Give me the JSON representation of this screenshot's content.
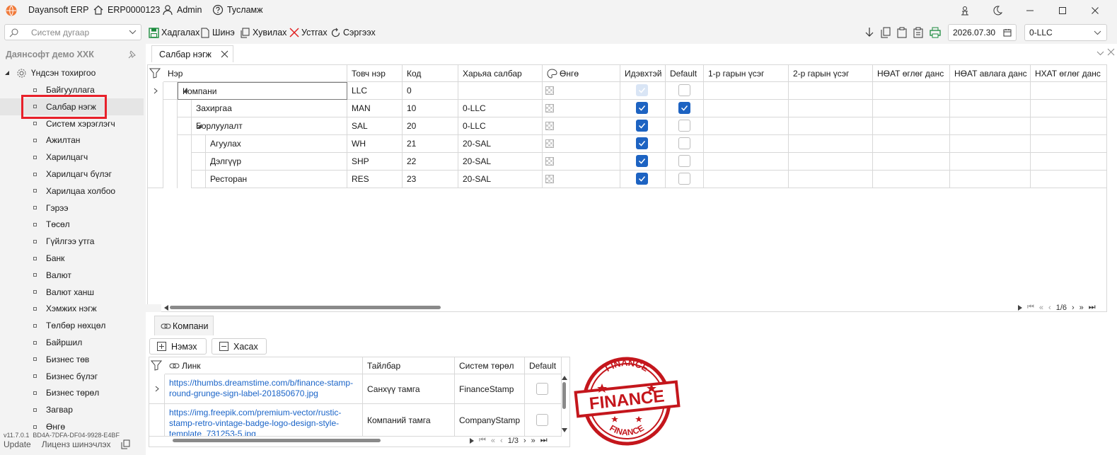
{
  "app": {
    "title": "Dayansoft ERP",
    "system_number": "ERP0000123",
    "user": "Admin",
    "help": "Тусламж"
  },
  "toolbar": {
    "search_placeholder": "Систем дугаар",
    "save": "Хадгалах",
    "new": "Шинэ",
    "copy": "Хувилах",
    "delete": "Устгах",
    "refresh": "Сэргээх",
    "date": "2026.07.30",
    "branch": "0-LLC"
  },
  "sidebar": {
    "title": "Даянсофт демо ХХК",
    "root": "Үндсэн тохиргоо",
    "items": [
      "Байгууллага",
      "Салбар нэгж",
      "Систем хэрэглэгч",
      "Ажилтан",
      "Харилцагч",
      "Харилцагч бүлэг",
      "Харилцаа холбоо",
      "Гэрээ",
      "Төсөл",
      "Гүйлгээ утга",
      "Банк",
      "Валют",
      "Валют ханш",
      "Хэмжих нэгж",
      "Төлбөр нөхцөл",
      "Байршил",
      "Бизнес төв",
      "Бизнес бүлэг",
      "Бизнес төрөл",
      "Загвар",
      "Өнгө"
    ],
    "selected_index": 1,
    "version": "v11.7.0.1",
    "license_code": "BD4A-7DFA-DF04-9928-E4BF",
    "update": "Update",
    "license_update": "Лиценз шинэчлэх"
  },
  "main": {
    "tab": "Салбар нэгж",
    "columns": [
      "Нэр",
      "Товч нэр",
      "Код",
      "Харьяа салбар",
      "Өнгө",
      "Идэвхтэй",
      "Default",
      "1-р гарын үсэг",
      "2-р гарын үсэг",
      "НӨАТ өглөг данс",
      "НӨАТ авлага данс",
      "НХАТ өглөг данс"
    ],
    "rows": [
      {
        "name": "Компани",
        "short": "LLC",
        "code": "0",
        "parent": "",
        "active": true,
        "active_dim": true,
        "default": false,
        "level": 0
      },
      {
        "name": "Захиргаа",
        "short": "MAN",
        "code": "10",
        "parent": "0-LLC",
        "active": true,
        "active_dim": false,
        "default": true,
        "level": 1
      },
      {
        "name": "Борлуулалт",
        "short": "SAL",
        "code": "20",
        "parent": "0-LLC",
        "active": true,
        "active_dim": false,
        "default": false,
        "level": 1
      },
      {
        "name": "Агуулах",
        "short": "WH",
        "code": "21",
        "parent": "20-SAL",
        "active": true,
        "active_dim": false,
        "default": false,
        "level": 2
      },
      {
        "name": "Дэлгүүр",
        "short": "SHP",
        "code": "22",
        "parent": "20-SAL",
        "active": true,
        "active_dim": false,
        "default": false,
        "level": 2
      },
      {
        "name": "Ресторан",
        "short": "RES",
        "code": "23",
        "parent": "20-SAL",
        "active": true,
        "active_dim": false,
        "default": false,
        "level": 2
      }
    ],
    "pager": "1/6"
  },
  "detail": {
    "tab": "Компани",
    "add": "Нэмэх",
    "remove": "Хасах",
    "columns": [
      "Линк",
      "Тайлбар",
      "Систем төрөл",
      "Default"
    ],
    "rows": [
      {
        "link_1": "https://thumbs.dreamstime.com/b/finance-stamp-",
        "link_2": "round-grunge-sign-label-201850670.jpg",
        "desc": "Санхүү тамга",
        "type": "FinanceStamp"
      },
      {
        "link_1": "https://img.freepik.com/premium-vector/rustic-",
        "link_2": "stamp-retro-vintage-badge-logo-design-style-",
        "link_3": "template_731253-5.jpg",
        "desc": "Компаний тамга",
        "type": "CompanyStamp"
      }
    ],
    "pager": "1/3",
    "stamp_text_top": "FINANCE",
    "stamp_text_main": "FINANCE",
    "stamp_text_bottom": "FINANCE"
  },
  "colors": {
    "accent": "#1d63c2",
    "highlight": "#e8202a",
    "link": "#1a64c8",
    "stamp": "#c4161c"
  }
}
